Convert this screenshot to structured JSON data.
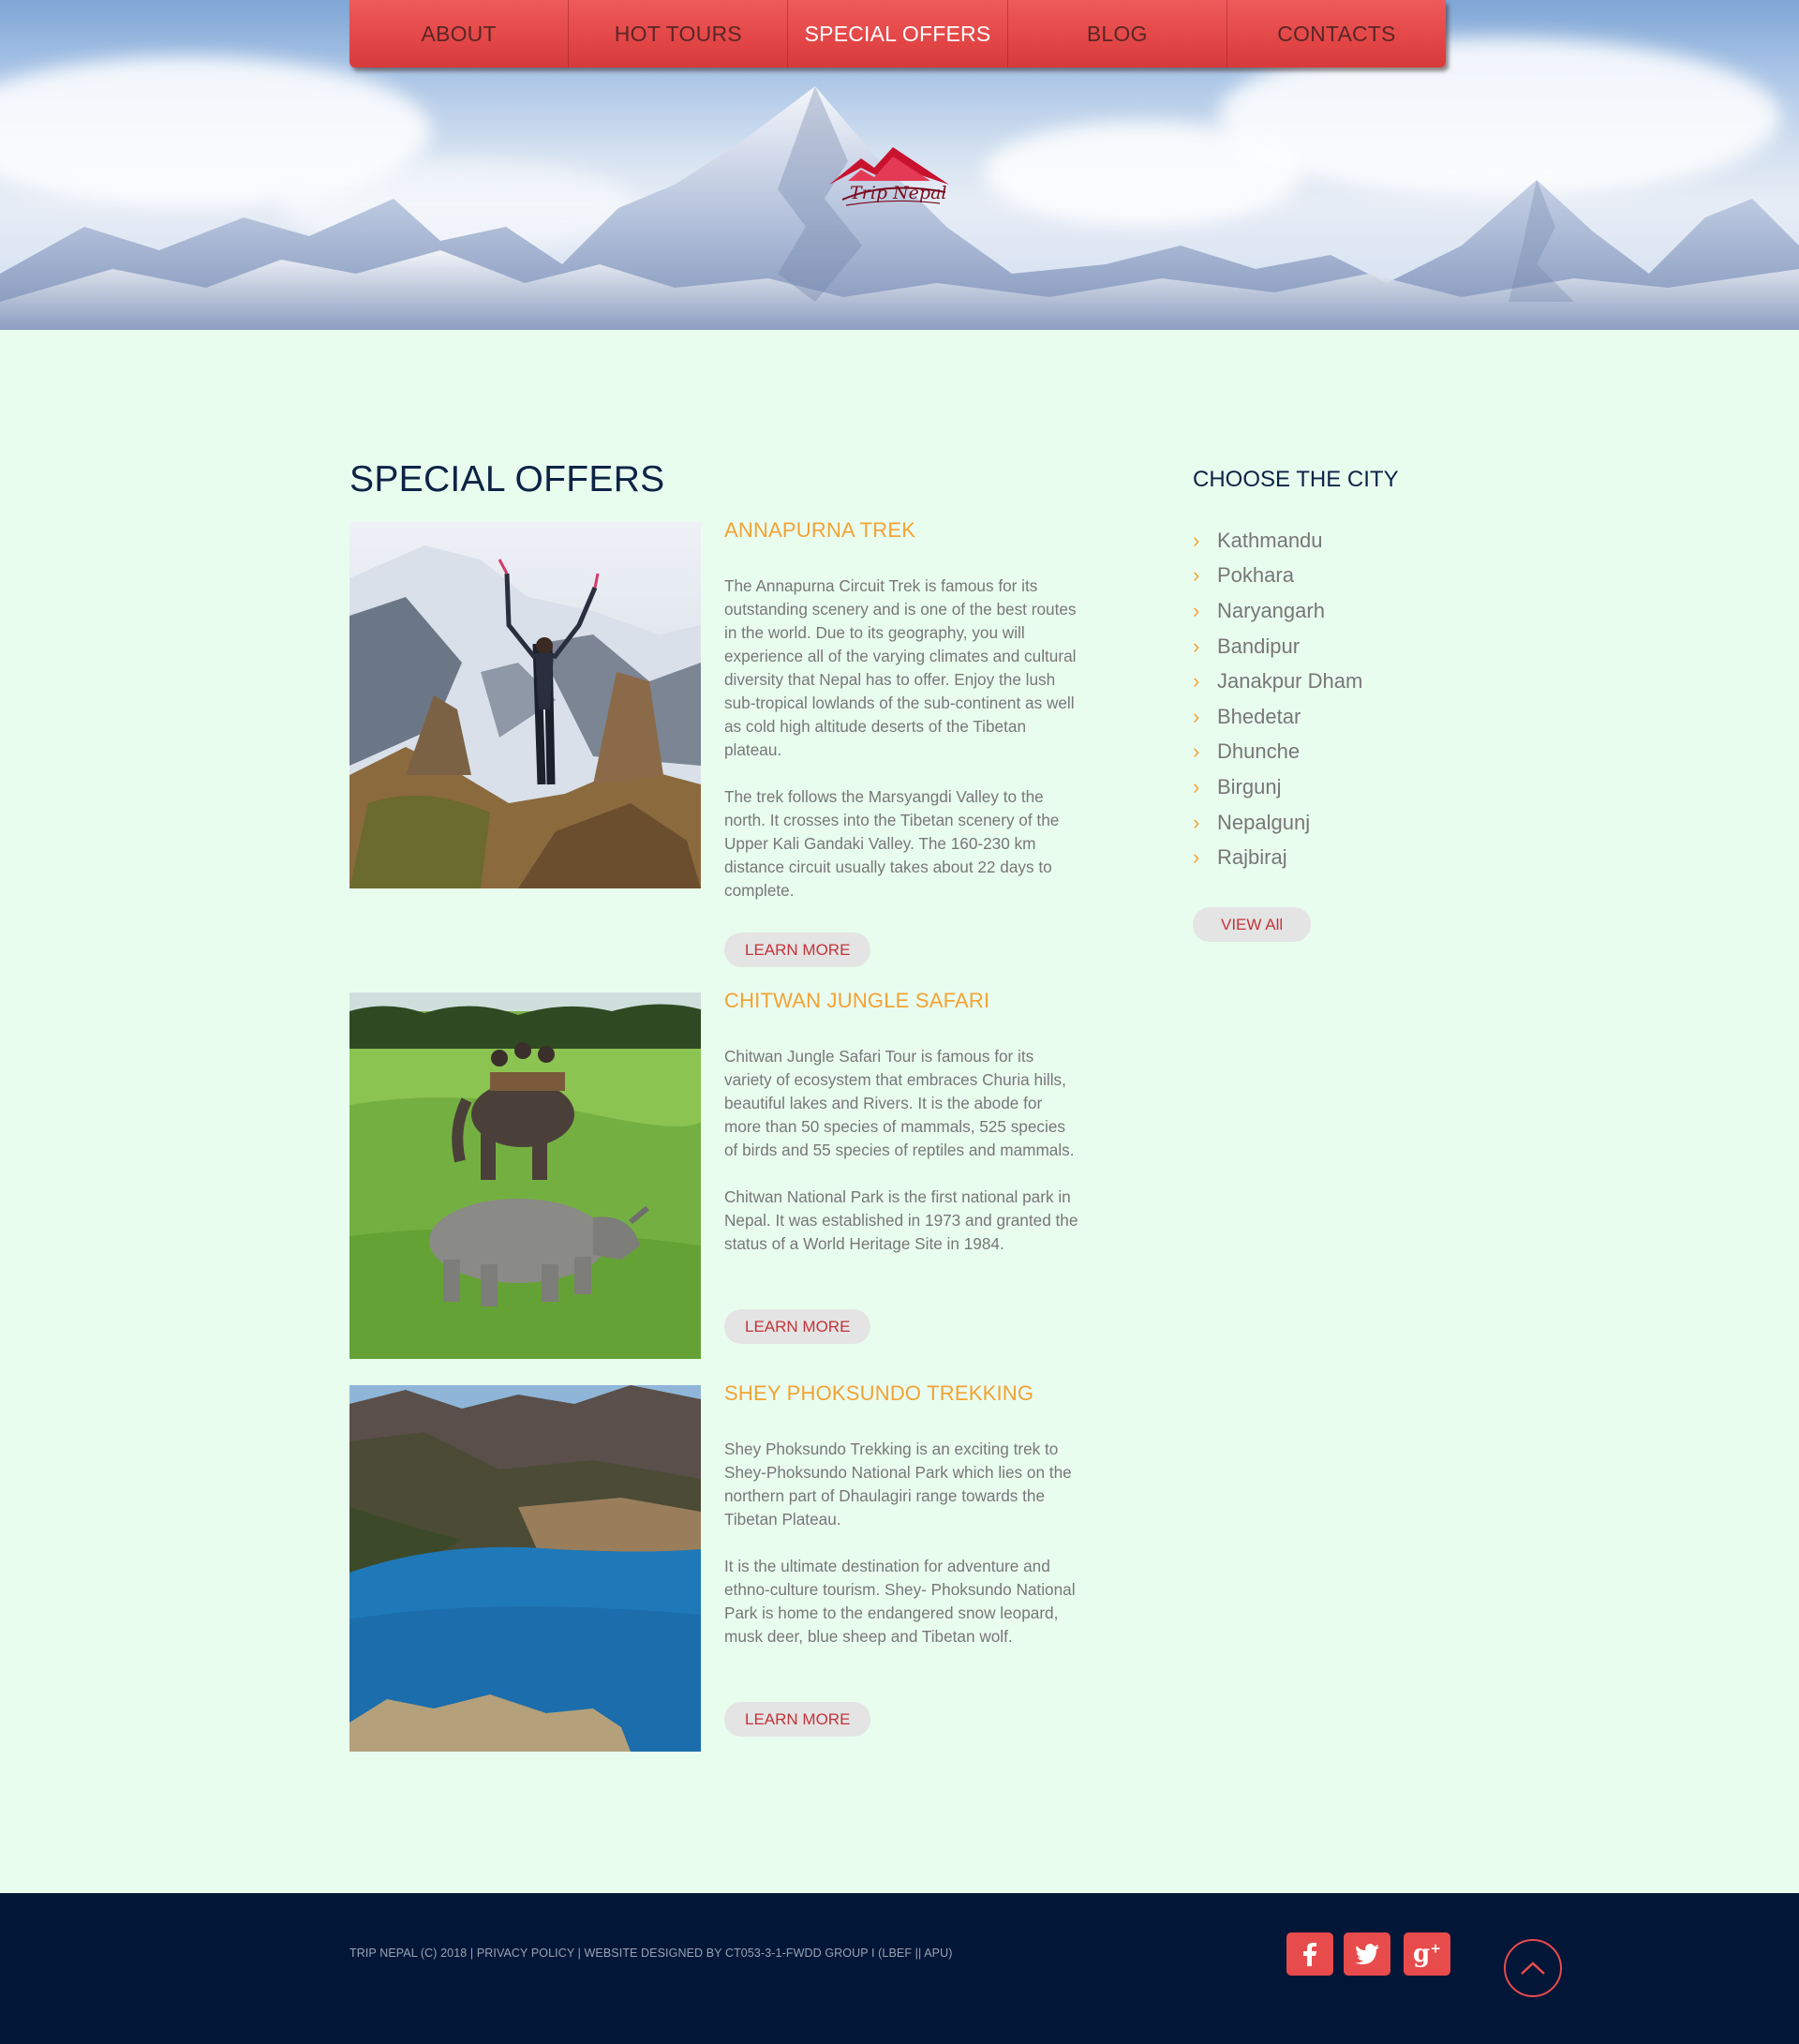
{
  "nav": {
    "items": [
      {
        "label": "ABOUT"
      },
      {
        "label": "HOT TOURS"
      },
      {
        "label": "SPECIAL OFFERS"
      },
      {
        "label": "BLOG"
      },
      {
        "label": "CONTACTS"
      }
    ],
    "active_index": 2
  },
  "logo": {
    "text": "Trip Nepal"
  },
  "main": {
    "title": "SPECIAL OFFERS",
    "offers": [
      {
        "title": "ANNAPURNA TREK",
        "paragraphs": [
          "The Annapurna Circuit Trek is famous for its outstanding scenery and is one of the best routes in the world. Due to its geography, you will experience all of the varying climates and cultural diversity that Nepal has to offer. Enjoy the lush sub-tropical lowlands of the sub-continent as well as cold high altitude deserts of the Tibetan plateau.",
          "The trek follows the Marsyangdi Valley to the north. It crosses into the Tibetan scenery of the Upper Kali Gandaki Valley. The 160-230 km distance circuit usually takes about 22 days to complete."
        ],
        "button": "LEARN MORE"
      },
      {
        "title": "CHITWAN JUNGLE SAFARI",
        "paragraphs": [
          "Chitwan Jungle Safari Tour is famous for its variety of ecosystem that embraces Churia hills, beautiful lakes and Rivers. It is the abode for more than 50 species of mammals, 525 species of birds and 55 species of reptiles and mammals.",
          "Chitwan National Park is the first national park in Nepal. It was established in 1973 and granted the status of a World Heritage Site in 1984."
        ],
        "button": "LEARN MORE"
      },
      {
        "title": "SHEY PHOKSUNDO TREKKING",
        "paragraphs": [
          "Shey Phoksundo Trekking is an exciting trek to Shey-Phoksundo National Park which lies on the northern part of Dhaulagiri range towards the Tibetan Plateau.",
          "It is the ultimate destination for adventure and ethno-culture tourism. Shey- Phoksundo National Park is home to the endangered snow leopard, musk deer, blue sheep and Tibetan wolf."
        ],
        "button": "LEARN MORE"
      }
    ]
  },
  "sidebar": {
    "title": "CHOOSE THE CITY",
    "cities": [
      "Kathmandu",
      "Pokhara",
      "Naryangarh",
      "Bandipur",
      "Janakpur Dham",
      "Bhedetar",
      "Dhunche",
      "Birgunj",
      "Nepalgunj",
      "Rajbiraj"
    ],
    "button": "VIEW All",
    "chevron_icon": "chevron-right-icon"
  },
  "footer": {
    "copyright": "TRIP NEPAL (C) 2018 | PRIVACY POLICY | WEBSITE DESIGNED BY CT053-3-1-FWDD GROUP I (LBEF || APU)",
    "social": [
      {
        "icon": "facebook-icon",
        "glyph": "f"
      },
      {
        "icon": "twitter-icon",
        "glyph": "t"
      },
      {
        "icon": "google-plus-icon",
        "glyph": "g+"
      }
    ],
    "back_to_top_icon": "chevron-up-icon"
  },
  "colors": {
    "nav_red": "#e34646",
    "accent_orange": "#f3a234",
    "navy": "#0d2345",
    "page_bg": "#e9fdef",
    "footer_bg": "#021638",
    "button_text": "#c5333a"
  }
}
